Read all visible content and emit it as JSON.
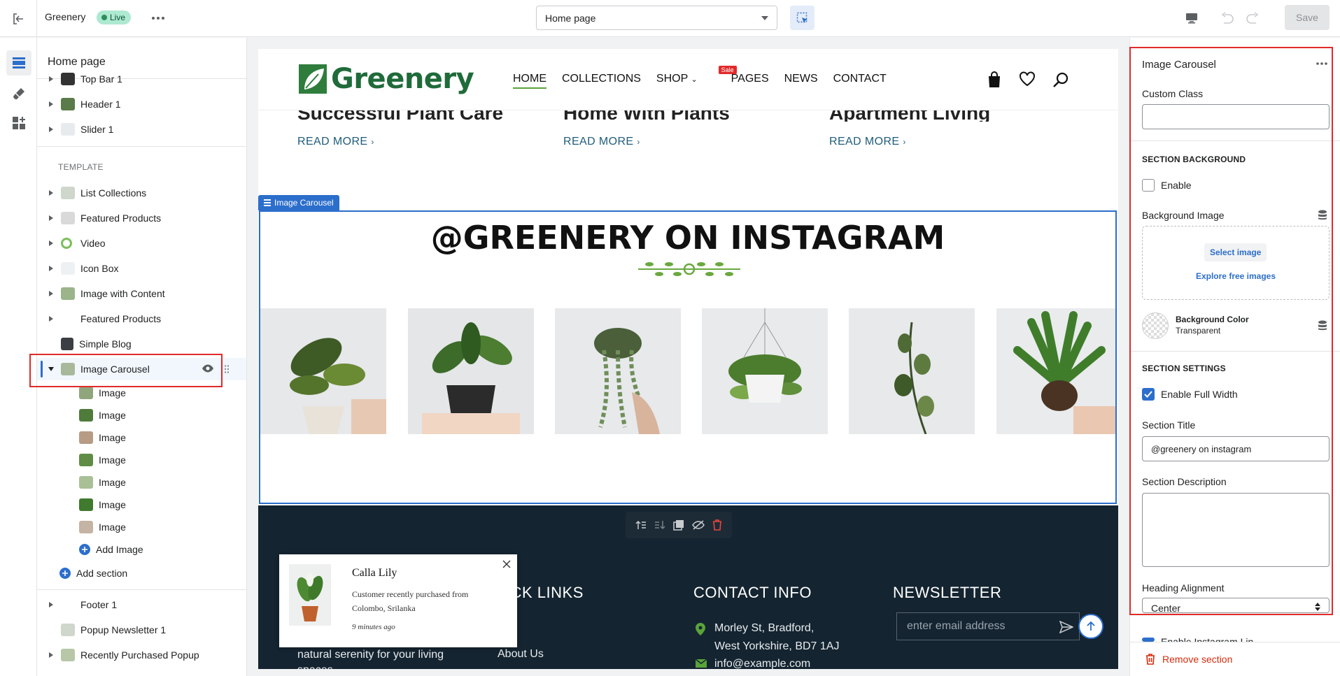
{
  "topbar": {
    "store_name": "Greenery",
    "status_badge": "Live",
    "page_selector_value": "Home page",
    "save_label": "Save"
  },
  "sidebar": {
    "title": "Home page",
    "header_sections": [
      {
        "label": "Top Bar 1"
      },
      {
        "label": "Header 1"
      },
      {
        "label": "Slider 1"
      }
    ],
    "template_label": "TEMPLATE",
    "template_sections": [
      {
        "label": "List Collections"
      },
      {
        "label": "Featured Products"
      },
      {
        "label": "Video"
      },
      {
        "label": "Icon Box"
      },
      {
        "label": "Image with Content"
      },
      {
        "label": "Featured Products"
      },
      {
        "label": "Simple Blog"
      },
      {
        "label": "Image Carousel"
      }
    ],
    "carousel_children": [
      "Image",
      "Image",
      "Image",
      "Image",
      "Image",
      "Image",
      "Image"
    ],
    "add_image_label": "Add Image",
    "add_section_label": "Add section",
    "footer_sections": [
      {
        "label": "Footer 1"
      },
      {
        "label": "Popup Newsletter 1"
      },
      {
        "label": "Recently Purchased Popup"
      }
    ]
  },
  "preview": {
    "logo_text": "Greenery",
    "nav": [
      "HOME",
      "COLLECTIONS",
      "SHOP",
      "PAGES",
      "NEWS",
      "CONTACT"
    ],
    "sale_tag": "Sale",
    "blog_titles": [
      "Successful Plant Care",
      "Home With Plants",
      "Apartment Living"
    ],
    "read_more": "READ MORE",
    "carousel_tag": "Image Carousel",
    "section_title": "@GREENERY ON INSTAGRAM",
    "footer": {
      "quick_links_heading": "QUICK LINKS",
      "contact_heading": "CONTACT INFO",
      "newsletter_heading": "NEWSLETTER",
      "about_partial": "natural serenity for your living",
      "about_partial_2": "spaces.",
      "link_home_partial": "me",
      "link_about": "About Us",
      "address_line1": "Morley St, Bradford,",
      "address_line2": "West Yorkshire, BD7 1AJ",
      "email": "info@example.com",
      "newsletter_placeholder": "enter email address"
    },
    "popup": {
      "product": "Calla Lily",
      "message_line1": "Customer recently purchased  from",
      "message_line2": "Colombo, Srilanka",
      "time": "9 minutes ago"
    }
  },
  "panel": {
    "title": "Image Carousel",
    "custom_class_label": "Custom Class",
    "custom_class_value": "",
    "section_background_heading": "SECTION BACKGROUND",
    "enable_label": "Enable",
    "enable_checked": false,
    "background_image_label": "Background Image",
    "select_image_label": "Select image",
    "explore_label": "Explore free images",
    "background_color_label": "Background Color",
    "background_color_value": "Transparent",
    "section_settings_heading": "SECTION SETTINGS",
    "full_width_label": "Enable Full Width",
    "full_width_checked": true,
    "section_title_label": "Section Title",
    "section_title_value": "@greenery on instagram",
    "section_description_label": "Section Description",
    "heading_alignment_label": "Heading Alignment",
    "heading_alignment_value": "Center",
    "partial_next_label": "Enable Instagram Lin",
    "remove_section_label": "Remove section"
  },
  "colors": {
    "accent_blue": "#2c6ecb",
    "highlight_red": "#e12a2a",
    "footer_dark": "#142430",
    "brand_green": "#1f6b3a"
  }
}
